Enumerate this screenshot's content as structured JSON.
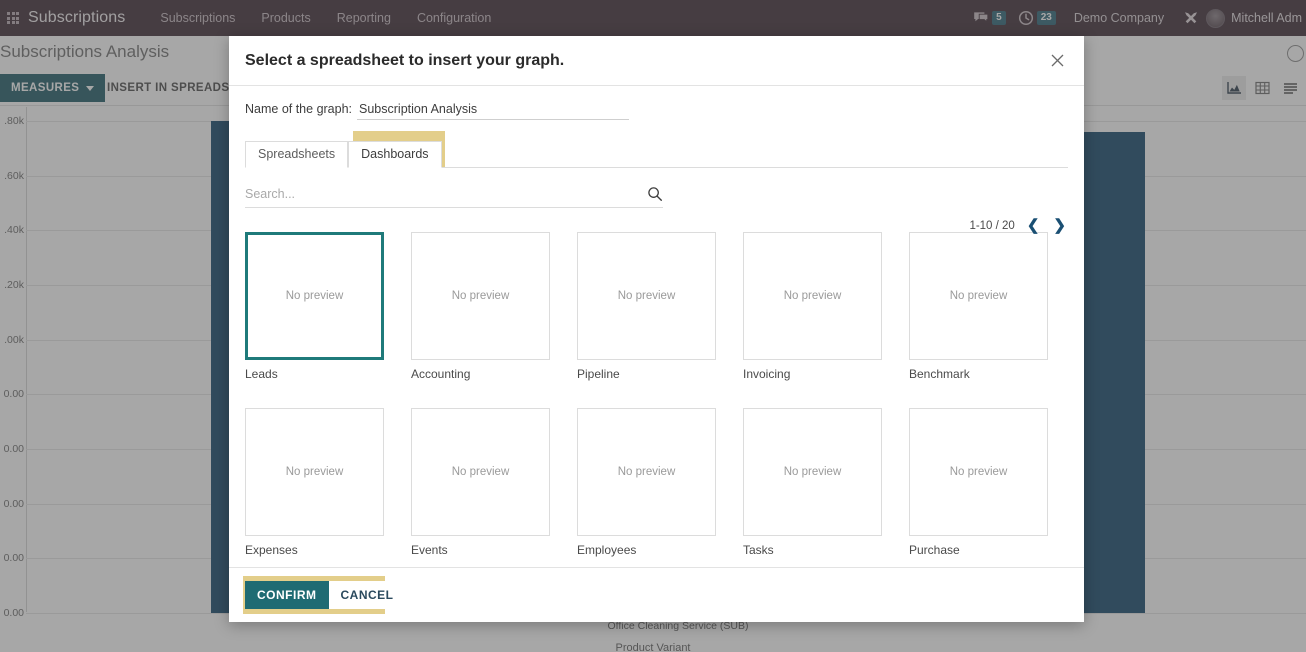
{
  "navbar": {
    "apps_icon": "apps-grid-icon",
    "brand": "Subscriptions",
    "links": [
      "Subscriptions",
      "Products",
      "Reporting",
      "Configuration"
    ],
    "messages_icon": "chat-icon",
    "messages_count": "5",
    "activities_icon": "clock-icon",
    "activities_count": "23",
    "company": "Demo Company",
    "tools_icon": "wrench-screwdriver-icon",
    "avatar_icon": "user-avatar",
    "username": "Mitchell Adm"
  },
  "breadcrumb": {
    "title": "Subscriptions Analysis",
    "right_icon": "search-circle-icon"
  },
  "controls": {
    "measures_label": "MEASURES",
    "measures_caret": "chevron-down-icon",
    "insert_label": "INSERT IN SPREADSHEET",
    "views": [
      {
        "name": "graph-view-icon",
        "label": "Graph",
        "active": true
      },
      {
        "name": "pivot-view-icon",
        "label": "Pivot",
        "active": false
      },
      {
        "name": "list-view-icon",
        "label": "List",
        "active": false
      }
    ]
  },
  "chart_data": {
    "type": "bar",
    "title": "Subscriptions Analysis",
    "xlabel": "Product Variant",
    "ylabel": "",
    "categories": [
      "Office Cleaning Service (SUB)",
      "Office Cleaning Service (SUB)"
    ],
    "values": [
      1800,
      1760
    ],
    "ylim": [
      0,
      1800
    ],
    "ytick_labels": [
      ".80k",
      ".60k",
      ".40k",
      ".20k",
      ".00k",
      "0.00",
      "0.00",
      "0.00",
      "0.00",
      "0.00"
    ],
    "ytick_values": [
      1800,
      1600,
      1400,
      1200,
      1000,
      800,
      600,
      400,
      200,
      0
    ],
    "bar_color": "#13466b",
    "grid": true,
    "legend": "none",
    "xtick_labels": [
      "Office Cleaning Service (SUB)"
    ]
  },
  "dialog": {
    "title": "Select a spreadsheet to insert your graph.",
    "close_icon": "close-icon",
    "name_label": "Name of the graph:",
    "name_value": "Subscription Analysis",
    "tabs": [
      {
        "label": "Spreadsheets",
        "active": false
      },
      {
        "label": "Dashboards",
        "active": true,
        "highlighted": true
      }
    ],
    "search_placeholder": "Search...",
    "search_value": "",
    "search_icon": "search-icon",
    "pager": {
      "range": "1-10 / 20",
      "prev_icon": "chevron-left-icon",
      "next_icon": "chevron-right-icon"
    },
    "no_preview_text": "No preview",
    "cards": [
      {
        "label": "Leads",
        "selected": true
      },
      {
        "label": "Accounting",
        "selected": false
      },
      {
        "label": "Pipeline",
        "selected": false
      },
      {
        "label": "Invoicing",
        "selected": false
      },
      {
        "label": "Benchmark",
        "selected": false
      },
      {
        "label": "Expenses",
        "selected": false
      },
      {
        "label": "Events",
        "selected": false
      },
      {
        "label": "Employees",
        "selected": false
      },
      {
        "label": "Tasks",
        "selected": false
      },
      {
        "label": "Purchase",
        "selected": false
      }
    ],
    "confirm_label": "CONFIRM",
    "cancel_label": "CANCEL"
  },
  "colors": {
    "navbar_bg": "#3c2b35",
    "accent_teal": "#1f5a66",
    "highlight_gold": "#e3ce8a",
    "bar_blue": "#13466b",
    "selected_border": "#1f7a7a"
  }
}
